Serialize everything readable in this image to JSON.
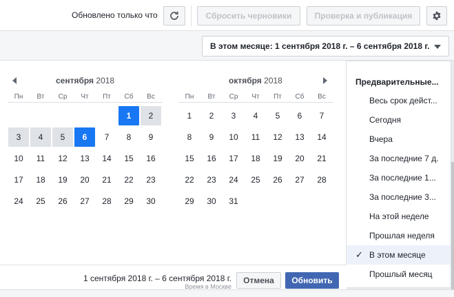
{
  "topbar": {
    "status": "Обновлено только что",
    "reset_label": "Сбросить черновики",
    "publish_label": "Проверка и публикация"
  },
  "date_picker": {
    "toggle_label": "В этом месяце: 1 сентября 2018 г. – 6 сентября 2018 г.",
    "left_month": {
      "name": "сентября",
      "year": "2018"
    },
    "right_month": {
      "name": "октября",
      "year": "2018"
    },
    "weekdays": [
      "Пн",
      "Вт",
      "Ср",
      "Чт",
      "Пт",
      "Сб",
      "Вс"
    ],
    "selected_start": 1,
    "selected_end": 6,
    "range_text": "1 сентября 2018 г. – 6 сентября 2018 г.",
    "timezone": "Время в Москве",
    "cancel_label": "Отмена",
    "update_label": "Обновить"
  },
  "presets": {
    "header": "Предварительные...",
    "items": [
      "Весь срок дейст...",
      "Сегодня",
      "Вчера",
      "За последние 7 д.",
      "За последние 1...",
      "За последние 3...",
      "На этой неделе",
      "Прошлая неделя",
      "В этом месяце",
      "Прошлый месяц"
    ],
    "active_index": 8
  },
  "colors": {
    "accent": "#1877f2",
    "primary_button": "#4267b2",
    "range": "#dfe2e6"
  },
  "icons": [
    "refresh-icon",
    "gear-icon",
    "caret-down-icon",
    "chevron-left-icon",
    "chevron-right-icon",
    "check-icon"
  ]
}
